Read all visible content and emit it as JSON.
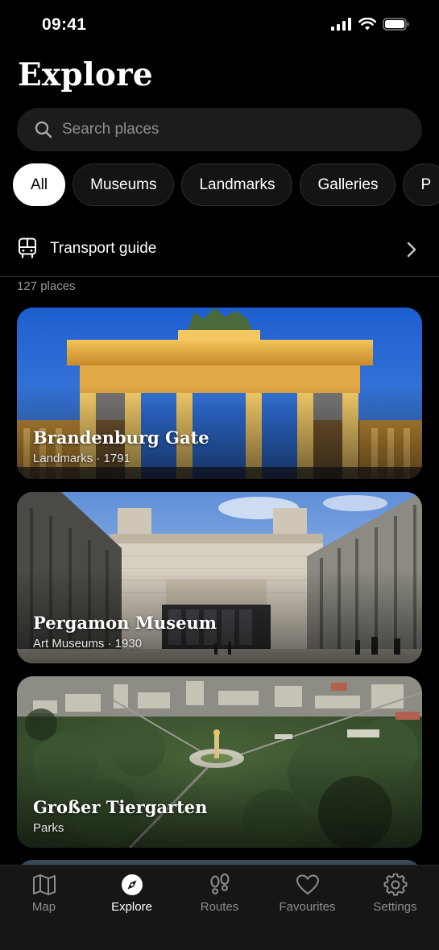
{
  "status": {
    "time": "09:41"
  },
  "header": {
    "title": "Explore"
  },
  "search": {
    "placeholder": "Search places"
  },
  "filters": [
    {
      "label": "All",
      "active": true
    },
    {
      "label": "Museums",
      "active": false
    },
    {
      "label": "Landmarks",
      "active": false
    },
    {
      "label": "Galleries",
      "active": false
    },
    {
      "label": "P",
      "active": false
    }
  ],
  "transport": {
    "label": "Transport guide"
  },
  "results": {
    "count_text": "127 places"
  },
  "places": [
    {
      "name": "Brandenburg Gate",
      "meta": "Landmarks · 1791"
    },
    {
      "name": "Pergamon Museum",
      "meta": "Art Museums · 1930"
    },
    {
      "name": "Großer Tiergarten",
      "meta": "Parks"
    }
  ],
  "tabs": [
    {
      "label": "Map",
      "icon": "map-icon"
    },
    {
      "label": "Explore",
      "icon": "compass-icon",
      "active": true
    },
    {
      "label": "Routes",
      "icon": "footprints-icon"
    },
    {
      "label": "Favourites",
      "icon": "heart-icon"
    },
    {
      "label": "Settings",
      "icon": "gear-icon"
    }
  ],
  "colors": {
    "background": "#000000",
    "surface": "#1c1c1e",
    "active_chip": "#ffffff",
    "muted": "#8e8e93"
  }
}
